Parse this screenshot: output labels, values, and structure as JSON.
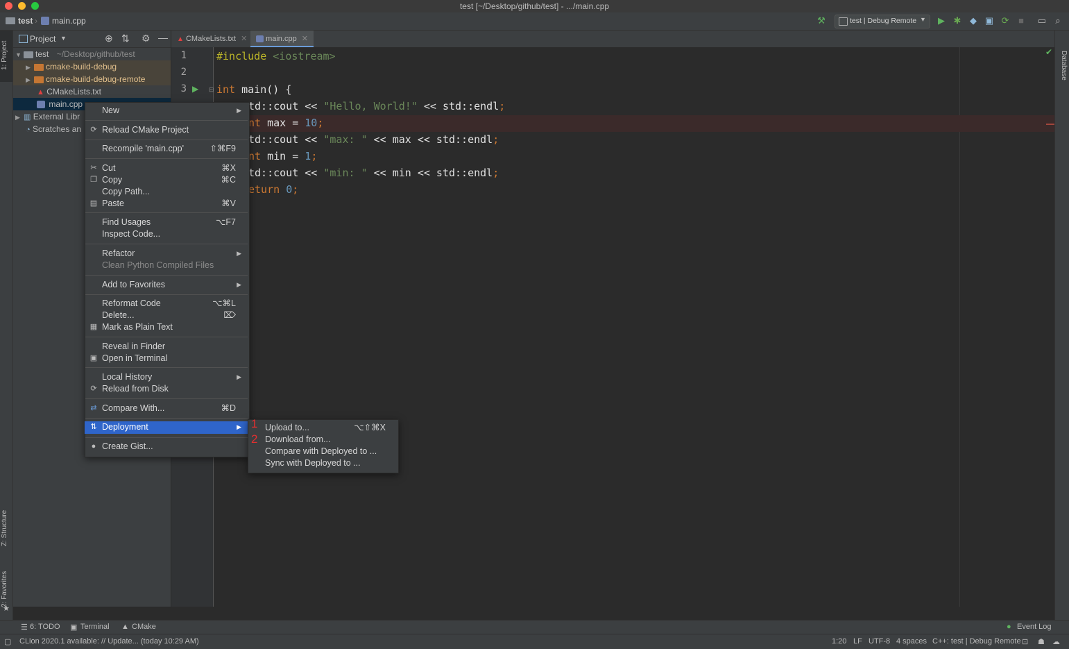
{
  "window": {
    "title": "test [~/Desktop/github/test] - .../main.cpp"
  },
  "breadcrumb": {
    "project": "test",
    "file": "main.cpp"
  },
  "toolbar": {
    "run_config": "test | Debug Remote"
  },
  "left_strip": {
    "project_tab": "1: Project",
    "structure_tab": "Z: Structure",
    "favorites_tab": "2: Favorites"
  },
  "right_strip": {
    "database_tab": "Database"
  },
  "project_panel": {
    "title": "Project",
    "tree": [
      {
        "label": "test",
        "path": "~/Desktop/github/test"
      },
      {
        "label": "cmake-build-debug"
      },
      {
        "label": "cmake-build-debug-remote"
      },
      {
        "label": "CMakeLists.txt"
      },
      {
        "label": "main.cpp"
      },
      {
        "label": "External Libr"
      },
      {
        "label": "Scratches an"
      }
    ]
  },
  "editor_tabs": [
    {
      "label": "CMakeLists.txt"
    },
    {
      "label": "main.cpp"
    }
  ],
  "code": {
    "line_numbers": [
      "1",
      "2",
      "3"
    ],
    "line1_pp": "#include",
    "line1_inc": " <iostream>",
    "line3_kw": "int",
    "line3_rest": " main() {",
    "line4_a": "td::cout << ",
    "line4_str": "\"Hello, World!\"",
    "line4_b": " << std::endl",
    "line5_kw": "nt",
    "line5_a": " max = ",
    "line5_num": "10",
    "line6_a": "td::cout << ",
    "line6_str": "\"max: \"",
    "line6_b": " << max << std::endl",
    "line7_kw": "nt",
    "line7_a": " min = ",
    "line7_num": "1",
    "line8_a": "td::cout << ",
    "line8_str": "\"min: \"",
    "line8_b": " << min << std::endl",
    "line9_kw": "eturn",
    "line9_num": "0",
    "semicolon": ";"
  },
  "context_menu": {
    "new": "New",
    "reload_cmake": "Reload CMake Project",
    "recompile": "Recompile 'main.cpp'",
    "recompile_sc": "⇧⌘F9",
    "cut": "Cut",
    "cut_sc": "⌘X",
    "copy": "Copy",
    "copy_sc": "⌘C",
    "copy_path": "Copy Path...",
    "paste": "Paste",
    "paste_sc": "⌘V",
    "find_usages": "Find Usages",
    "find_usages_sc": "⌥F7",
    "inspect_code": "Inspect Code...",
    "refactor": "Refactor",
    "clean_python": "Clean Python Compiled Files",
    "add_favorites": "Add to Favorites",
    "reformat": "Reformat Code",
    "reformat_sc": "⌥⌘L",
    "delete": "Delete...",
    "delete_sc": "⌦",
    "mark_plain": "Mark as Plain Text",
    "reveal_finder": "Reveal in Finder",
    "open_terminal": "Open in Terminal",
    "local_history": "Local History",
    "reload_disk": "Reload from Disk",
    "compare_with": "Compare With...",
    "compare_with_sc": "⌘D",
    "deployment": "Deployment",
    "create_gist": "Create Gist..."
  },
  "deployment_submenu": {
    "upload": "Upload to...",
    "upload_sc": "⌥⇧⌘X",
    "download": "Download from...",
    "compare_deployed": "Compare with Deployed to ...",
    "sync_deployed": "Sync with Deployed to ...",
    "marker1": "1",
    "marker2": "2"
  },
  "bottom_tools": {
    "todo": "6: TODO",
    "terminal": "Terminal",
    "cmake": "CMake",
    "event_log": "Event Log"
  },
  "status_bar": {
    "message": "CLion 2020.1 available: // Update... (today 10:29 AM)",
    "position": "1:20",
    "line_sep": "LF",
    "encoding": "UTF-8",
    "indent": "4 spaces",
    "context": "C++: test | Debug Remote"
  },
  "colors": {
    "accent": "#2f65ca",
    "bg": "#2b2b2b",
    "panel": "#3c3f41",
    "folder": "#c57633"
  }
}
